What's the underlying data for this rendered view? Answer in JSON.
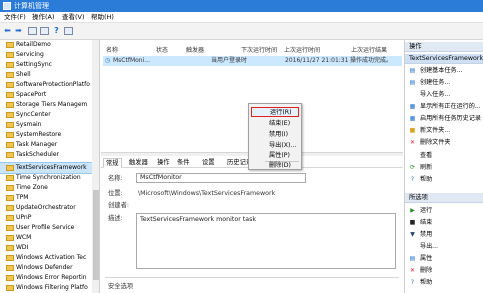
{
  "window": {
    "title": "计算机管理"
  },
  "menu": [
    "文件(F)",
    "操作(A)",
    "查看(V)",
    "帮助(H)"
  ],
  "tree": {
    "items": [
      "RetailDemo",
      "Servicing",
      "SettingSync",
      "Shell",
      "SoftwareProtectionPlatfo",
      "SpacePort",
      "Storage Tiers Managem",
      "SyncCenter",
      "Sysmain",
      "SystemRestore",
      "Task Manager",
      "TaskScheduler",
      "TextServicesFramework",
      "Time Synchronization",
      "Time Zone",
      "TPM",
      "UpdateOrchestrator",
      "UPnP",
      "User Profile Service",
      "WCM",
      "WDI",
      "Windows Activation Tec",
      "Windows Defender",
      "Windows Error Reportin",
      "Windows Filtering Platfo"
    ],
    "selected": "TextServicesFramework"
  },
  "task_list": {
    "columns": [
      "名称",
      "状态",
      "触发器",
      "下次运行时间",
      "上次运行时间",
      "上次运行结果"
    ],
    "row": {
      "name": "MsCtfMoni...",
      "trigger": "当用户登录时",
      "last_run": "2016/11/27 21:01:31",
      "result": "操作成功完成。"
    }
  },
  "context_menu": {
    "items": [
      "运行(R)",
      "结束(E)",
      "禁用(I)",
      "导出(X)...",
      "属性(P)",
      "删除(D)"
    ],
    "highlighted": "运行(R)"
  },
  "detail": {
    "tabs": [
      "常规",
      "触发器",
      "操作",
      "条件",
      "设置",
      "历史记录(已禁用)"
    ],
    "active_tab": "常规",
    "name_label": "名称:",
    "name_value": "MsCtfMonitor",
    "location_label": "位置:",
    "location_value": "\\Microsoft\\Windows\\TextServicesFramework",
    "author_label": "创建者:",
    "author_value": "",
    "desc_label": "描述:",
    "desc_value": "TextServicesFramework monitor task",
    "security_label": "安全选项"
  },
  "actions": {
    "section1_title": "操作",
    "section1_header": "TextServicesFramework",
    "section1_items": [
      "创建基本任务...",
      "创建任务...",
      "导入任务...",
      "显示所有正在运行的...",
      "启用所有任务历史记录",
      "新文件夹...",
      "删除文件夹",
      "查看",
      "刷新",
      "帮助"
    ],
    "section2_title": "所选项",
    "section2_items": [
      "运行",
      "结束",
      "禁用",
      "导出...",
      "属性",
      "删除",
      "帮助"
    ]
  },
  "colors": {
    "titlebar": "#2b7bd9",
    "selection": "#cce4f7",
    "highlight_border": "#e02020",
    "accent_blue": "#1f6fd1"
  }
}
